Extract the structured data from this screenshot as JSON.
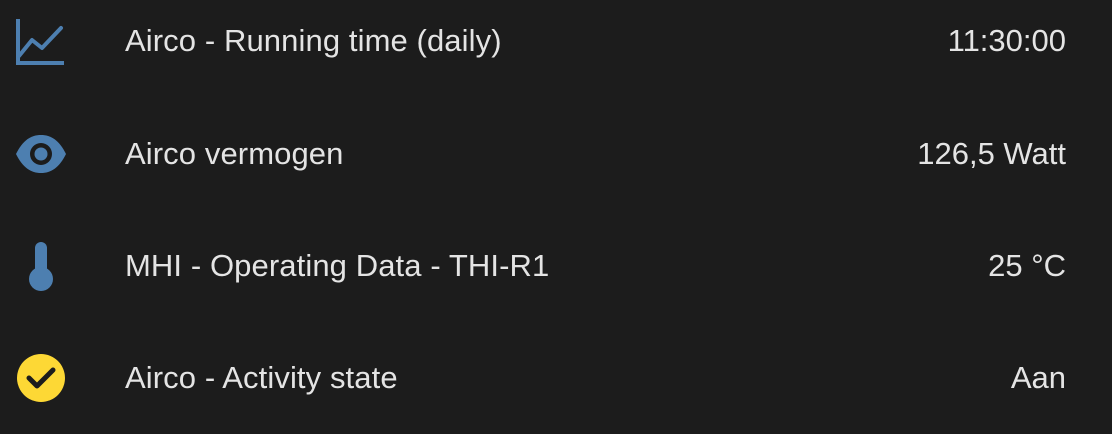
{
  "colors": {
    "background": "#1c1c1c",
    "text": "#e4e4e4",
    "icon_default": "#4d7fb0",
    "icon_active": "#fdd835"
  },
  "entities": [
    {
      "icon": "chart-line-icon",
      "name": "Airco - Running time (daily)",
      "state": "11:30:00"
    },
    {
      "icon": "eye-icon",
      "name": "Airco vermogen",
      "state": "126,5 Watt"
    },
    {
      "icon": "thermometer-icon",
      "name": "MHI - Operating Data - THI-R1",
      "state": "25 °C"
    },
    {
      "icon": "check-circle-icon",
      "name": "Airco - Activity state",
      "state": "Aan"
    }
  ]
}
